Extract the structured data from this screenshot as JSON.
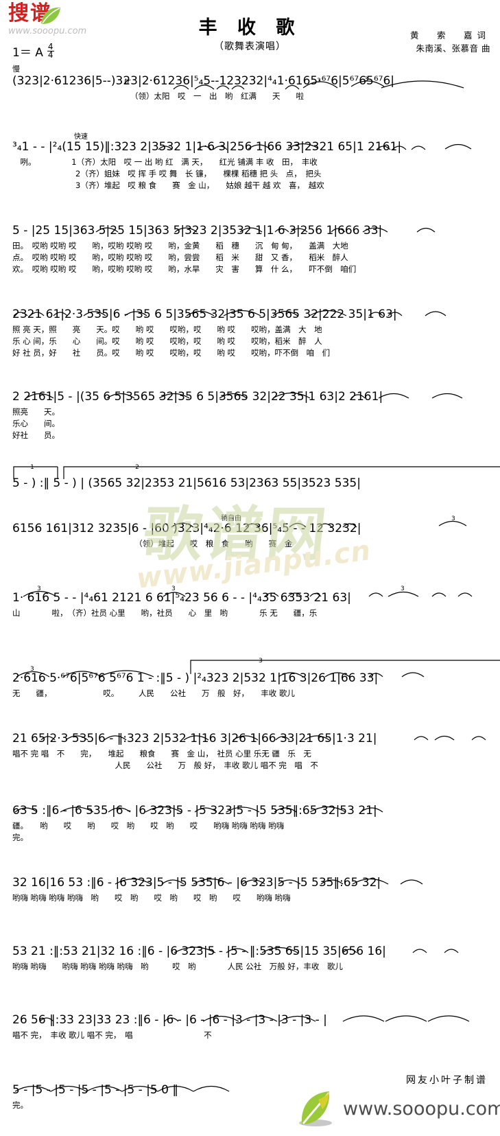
{
  "site": {
    "logo_text": "搜谱",
    "logo_url": "www.sooopu.com",
    "watermark_chars": "歌谱网",
    "watermark_url": "www.jianpu.cn",
    "footer_url": "www.sooopu.com",
    "footer_credit": "网友小叶子制谱"
  },
  "header": {
    "title": "丰 收 歌",
    "subtitle": "（歌舞表演唱）",
    "lyricist_line": "黄　索　嘉词",
    "composer_line": "朱南溪、张慕音 曲",
    "key_label": "1＝ A",
    "time_numerator": "4",
    "time_denominator": "4",
    "tempo_slow": "慢",
    "tempo_fast": "快速",
    "tempo_free": "稍自由"
  },
  "score": {
    "type": "jianpu",
    "systems": [
      {
        "id": "system-1",
        "notes": "(3 2 3 | 2 · 6 1 2 3 6 | 5 - -) 3 2 3 | 2 · 6 1 2 3 6 | 5/4 5 - - 1 2 3 2 3 2 | 4/4 1 · 6 1 6 5 · 67 6 | 5 67 6 5 67 6 |",
        "notes_plain": "(323|2·61236|5--)323|2·61236|⁵₄5--123232|⁴₄1·6165·⁶⁷6|5⁶⁷65⁶⁷6|",
        "lyrics": [
          "（领）太阳　哎　一　出　哟　红满　　天　　啦"
        ],
        "marks": [
          "tr"
        ]
      },
      {
        "id": "system-2",
        "notes_plain": "³₄1 - - |²₄(15 15)‖:323 2|3532 1|1·6 3|256 1|66 33|2321 65|1 2161|",
        "lyrics": [
          "　咧。　　　　　1（齐）太阳　哎 一 出 哟 红　满 天，　　红光 铺满 丰 收　田，　丰收",
          "　　　　　　　　2（齐）姐妹　哎 挥 手 哎 舞　长 镰，　　棵棵 稻穗 把 头　点，　把头",
          "　　　　　　　　3（齐）堆起　哎 粮 食　　赛　金 山，　　姑娘 越干 越 欢　喜，　越欢"
        ],
        "marks": [
          "快速"
        ]
      },
      {
        "id": "system-3",
        "notes_plain": "5 - |25 15|363 5|25 15|363 5|323 2|3532 1|1 6 3|256 1|666 33|",
        "lyrics": [
          "田。　哎哟 哎哟 哎　　哟，哎哟 哎哟 哎　　哟，金黄　　稻　穗　　沉　甸 甸，　　盖满　大地",
          "点。　哎哟 哎哟 哎　　哟，哎哟 哎哟 哎　　哟，尝尝　　稻　米　　甜　又 香，　　稻米　醉人",
          "欢。　哎哟 哎哟 哎　　哟，哎哟 哎哟 哎　　哟，水旱　　灾　害　　算　什 么，　　吓不倒　咱们"
        ]
      },
      {
        "id": "system-4",
        "notes_plain": "2321 61|2·3 535|6 - |35 6 5|3565 32|35 6 5|3565 32|222 35|1 63|",
        "lyrics": [
          "照 亮 天，照　　亮　　天。哎　　哟 哎　　哎哟，哎　　哟 哎　　哎哟，盖满　大　地",
          "乐 心 间，乐　　心　　间。哎　　哟 哎　　哎哟，哎　　哟 哎　　哎哟，稻米　醉　人",
          "好 社 员，好　　社　　员。哎　　哟 哎　　哎哟，哎　　哟 哎　　哎哟，吓不倒　咱　们"
        ]
      },
      {
        "id": "system-5",
        "notes_plain": "2 2161|5 - |(35 6 5|3565 32|35 6 5|3565 32|22 35|1 63|2 2161|",
        "lyrics": [
          "照亮　　天。",
          "乐心　　间。",
          "好社　　员。"
        ]
      },
      {
        "id": "system-6",
        "notes_plain": "5 - ) :‖ 5 - ) | (3565 32|2353 21|5616 53|2363 55|3523 535|",
        "lyrics": [],
        "marks": [
          "ending-1",
          "ending-2"
        ],
        "ending_1_label": "1",
        "ending_2_label": "2"
      },
      {
        "id": "system-7",
        "notes_plain": "6156 161|312 3235|6 - |60 )323|⁴₄2·6 12 36|⁵₄5 - - 12 3232|",
        "lyrics": [
          "　　　　　　　　　　　　　　　　（领）堆起　　哎　粮　食　　哟　　赛　金"
        ],
        "marks": [
          "稍自由"
        ]
      },
      {
        "id": "system-8",
        "notes_plain": "1· 616 5 - - |⁴₄61 2121 6 61|⁵₄23 56 6 - - |⁴₄35 6353 21 63|",
        "lyrics": [
          "山　　　　啦，　（齐）社员 心里　　哟，社员　　心　里　哟　　　　乐 无　　疆，乐"
        ]
      },
      {
        "id": "system-9",
        "notes_plain": "2·616 5·⁶⁷6|5⁶⁷6 5⁶⁷6 1 - :‖5 - ) |²₄323 2|532 1|16 3|26 1|66 33|",
        "lyrics": [
          "无　　疆，　　　　　　　哎。　　　人民　　公社　　万　般　好，　　丰收 歌儿"
        ],
        "marks": [
          "ending-3"
        ],
        "ending_3_label": "3"
      },
      {
        "id": "system-10",
        "notes_plain": "21 65|2·3 535|6 - ‖:323 2|532 1|16 3|26 1|66 33|21 65|1·3 21|",
        "lyrics": [
          "唱不 完 唱　不　　完，　　堆起　　粮食　　赛　金 山，　社员 心里 乐无 疆　乐　无",
          "　　　　　　　　　　　　　人民　　公社　　万　般 好，　丰收 歌儿 唱不 完　唱　不"
        ]
      },
      {
        "id": "system-11",
        "notes_plain": "63 5 :‖6 - |6 535 |6 - |6 323|5 - |5 323|5 - |5 535‖:65 32|53 21|",
        "lyrics": [
          "疆。　　哟　　哎　　哟　　哎　哟　　哎　哟　　哎　　哟嗨 哟嗨 哟嗨 哟嗨",
          "完。"
        ]
      },
      {
        "id": "system-12",
        "notes_plain": "32 16|16 53 :‖6 - |6 323|5 - |5 535|6 - |6 323|5 - |5 535‖:65 32|",
        "lyrics": [
          "哟嗨 哟嗨 哟嗨 哟嗨　哟　　哎　哟　　哎　哟　　哎　哟　　哎　　哟嗨 哟嗨"
        ]
      },
      {
        "id": "system-13",
        "notes_plain": "53 21 :‖:53 21|32 16 :‖6 - |6 323|5 - |5 - ‖:535 65|15 35|656 16|",
        "lyrics": [
          "哟嗨 哟嗨　　哟嗨 哟嗨 哟嗨 哟嗨　哟　　　哎　哟　　　　人民 公社　万般 好，丰收　歌儿"
        ]
      },
      {
        "id": "system-14",
        "notes_plain": "26 56 ‖:33 23|33 23 :‖6 - |6 - |6 - |6 - |3 - |3 - |3 - |3 - |",
        "lyrics": [
          "唱不 完，　丰收 歌儿 唱不 完，　唱　　　　　　　　　不"
        ]
      },
      {
        "id": "system-15",
        "notes_plain": "5 - |5 - |5 - |5 - |5 - |5 - |5 0 ‖",
        "lyrics": [
          "完。"
        ]
      }
    ]
  }
}
